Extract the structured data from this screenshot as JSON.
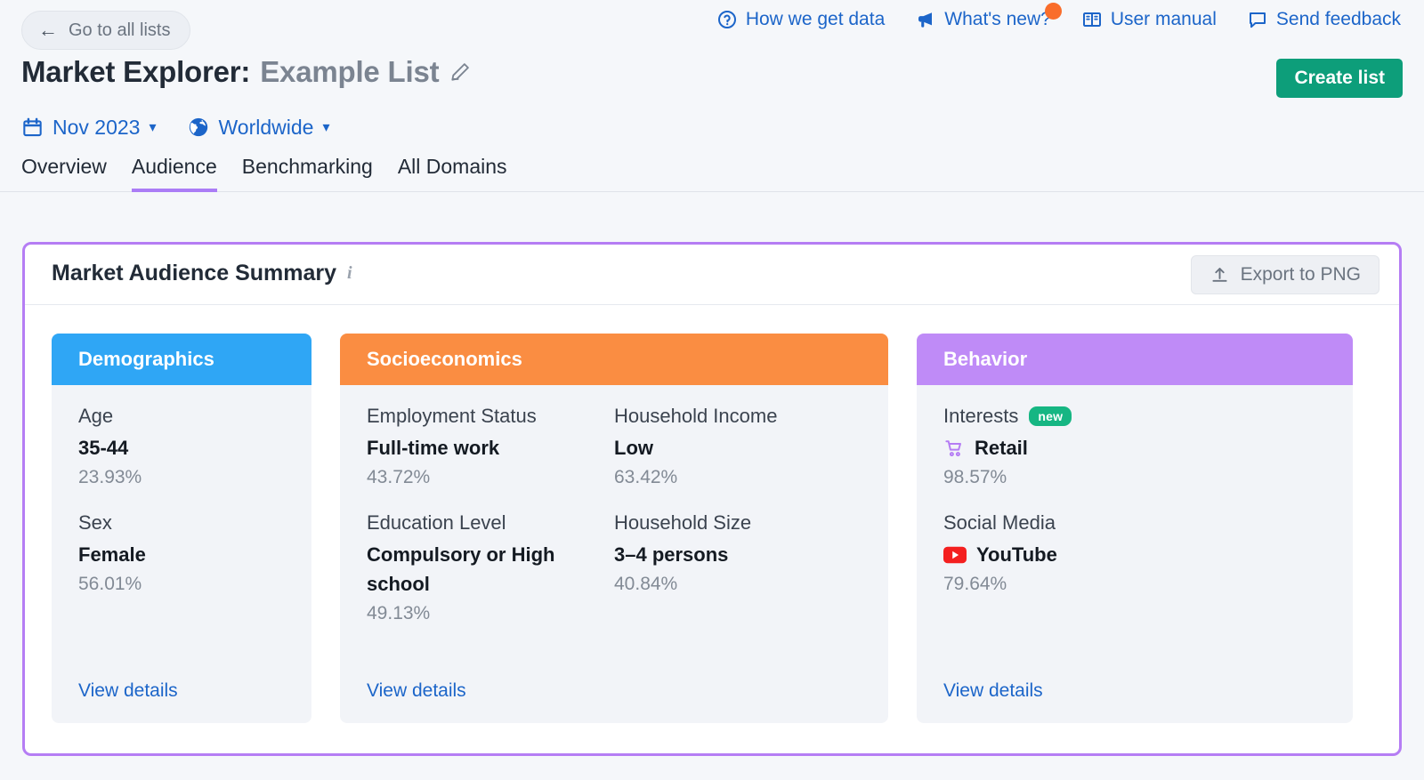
{
  "topbar": {
    "back_label": "Go to all lists",
    "back_icon": "arrow-left-icon",
    "links": [
      {
        "label": "How we get data",
        "icon": "question-circle-icon",
        "has_dot": false
      },
      {
        "label": "What's new?",
        "icon": "megaphone-icon",
        "has_dot": true
      },
      {
        "label": "User manual",
        "icon": "book-icon",
        "has_dot": false
      },
      {
        "label": "Send feedback",
        "icon": "speech-bubble-icon",
        "has_dot": false
      }
    ]
  },
  "header": {
    "title_prefix": "Market Explorer:",
    "list_name": "Example List",
    "edit_icon": "pencil-icon",
    "create_button": "Create list"
  },
  "filters": [
    {
      "label": "Nov 2023",
      "icon": "calendar-icon",
      "caret": "⌄"
    },
    {
      "label": "Worldwide",
      "icon": "globe-icon",
      "caret": "⌄"
    }
  ],
  "tabs": [
    {
      "label": "Overview",
      "active": false
    },
    {
      "label": "Audience",
      "active": true
    },
    {
      "label": "Benchmarking",
      "active": false
    },
    {
      "label": "All Domains",
      "active": false
    }
  ],
  "panel": {
    "title": "Market Audience Summary",
    "info_icon": "info-icon",
    "export_button": "Export to PNG",
    "export_icon": "upload-icon",
    "accent_color": "#b57df4",
    "columns": [
      {
        "key": "demographics",
        "heading": "Demographics",
        "color": "#2fa6f5",
        "view_details": "View details",
        "metrics": [
          {
            "label": "Age",
            "value": "35-44",
            "pct": "23.93%"
          },
          {
            "label": "Sex",
            "value": "Female",
            "pct": "56.01%"
          }
        ]
      },
      {
        "key": "socioeconomics",
        "heading": "Socioeconomics",
        "color": "#fa8d42",
        "view_details": "View details",
        "metrics_left": [
          {
            "label": "Employment Status",
            "value": "Full-time work",
            "pct": "43.72%"
          },
          {
            "label": "Education Level",
            "value": "Compulsory or High school",
            "pct": "49.13%"
          }
        ],
        "metrics_right": [
          {
            "label": "Household Income",
            "value": "Low",
            "pct": "63.42%"
          },
          {
            "label": "Household Size",
            "value": "3–4 persons",
            "pct": "40.84%"
          }
        ]
      },
      {
        "key": "behavior",
        "heading": "Behavior",
        "color": "#bf8bf7",
        "view_details": "View details",
        "metrics": [
          {
            "label": "Interests",
            "badge": "new",
            "value": "Retail",
            "pct": "98.57%",
            "icon": "shopping-cart-icon"
          },
          {
            "label": "Social Media",
            "value": "YouTube",
            "pct": "79.64%",
            "icon": "youtube-icon"
          }
        ]
      }
    ]
  }
}
